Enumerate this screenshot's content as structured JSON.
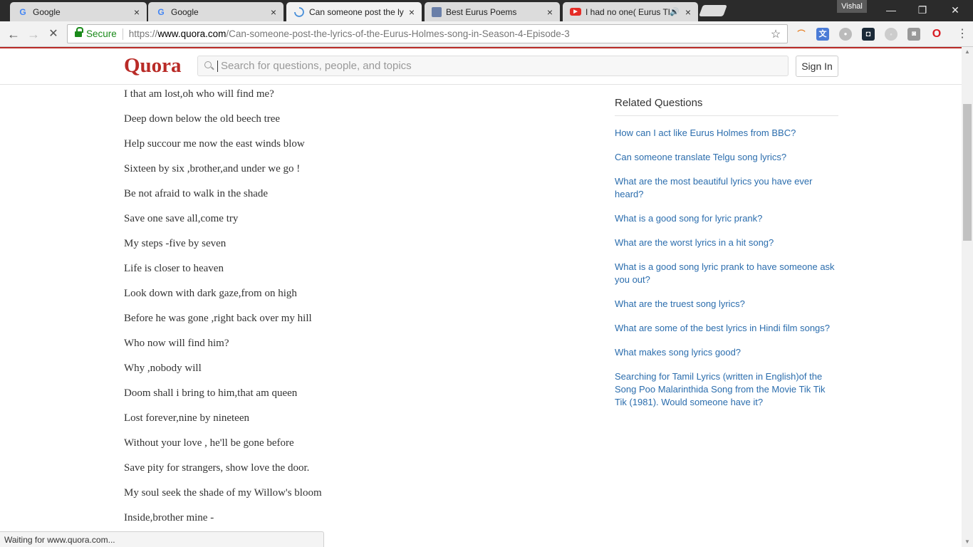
{
  "browser": {
    "tabs": [
      {
        "title": "Google",
        "icon": "google-icon",
        "active": false
      },
      {
        "title": "Google",
        "icon": "google-icon",
        "active": false
      },
      {
        "title": "Can someone post the ly",
        "icon": "loading-spinner-icon",
        "active": true
      },
      {
        "title": "Best Eurus Poems",
        "icon": "poems-site-icon",
        "active": false
      },
      {
        "title": "I had no one( Eurus Th",
        "icon": "youtube-icon",
        "active": false,
        "audio": true
      }
    ],
    "profile_name": "Vishal",
    "window_controls": {
      "minimize": "—",
      "restore": "❐",
      "close": "✕"
    },
    "omnibox": {
      "secure_label": "Secure",
      "url_scheme": "https://",
      "url_host": "www.quora.com",
      "url_path": "/Can-someone-post-the-lyrics-of-the-Eurus-Holmes-song-in-Season-4-Episode-3"
    },
    "status_text": "Waiting for www.quora.com..."
  },
  "page": {
    "logo": "Quora",
    "search": {
      "placeholder": "Search for questions, people, and topics",
      "value": ""
    },
    "sign_in_label": "Sign In",
    "lyrics": [
      "I that am lost,oh who will find me?",
      "Deep down below the old beech tree",
      "Help succour me now the east winds blow",
      "Sixteen by six ,brother,and under we go !",
      "Be not afraid to walk in the shade",
      "Save one save all,come try",
      "My steps -five by seven",
      "Life is closer to heaven",
      "Look down with dark gaze,from on high",
      "Before he was gone ,right back over my hill",
      "Who now will find him?",
      "Why ,nobody will",
      "Doom shall i bring to him,that am queen",
      "Lost forever,nine by nineteen",
      "Without your love , he'll be gone before",
      "Save pity for strangers, show love the door.",
      "My soul seek the shade of my Willow's bloom",
      "Inside,brother mine -"
    ],
    "related": {
      "heading": "Related Questions",
      "questions": [
        "How can I act like Eurus Holmes from BBC?",
        "Can someone translate Telgu song lyrics?",
        "What are the most beautiful lyrics you have ever heard?",
        "What is a good song for lyric prank?",
        "What are the worst lyrics in a hit song?",
        "What is a good song lyric prank to have someone ask you out?",
        "What are the truest song lyrics?",
        "What are some of the best lyrics in Hindi film songs?",
        "What makes song lyrics good?",
        "Searching for Tamil Lyrics (written in English)of the Song Poo Malarinthida Song from the Movie Tik Tik Tik (1981). Would someone have it?"
      ]
    }
  },
  "colors": {
    "quora_red": "#b92b27",
    "link_blue": "#2b6dad",
    "secure_green": "#1a8a1a"
  }
}
